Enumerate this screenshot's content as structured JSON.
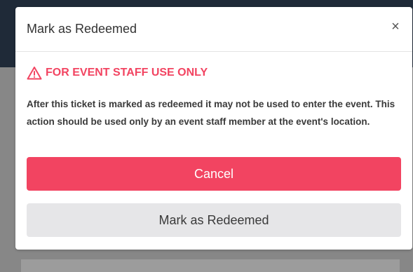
{
  "modal": {
    "title": "Mark as Redeemed",
    "close_icon": "close-icon",
    "close_glyph": "×",
    "warning": {
      "icon": "warning-triangle-icon",
      "text": "FOR EVENT STAFF USE ONLY",
      "color": "#f24461"
    },
    "description": "After this ticket is marked as redeemed it may not be used to enter the event. This action should be used only by an event staff member at the event's location.",
    "cancel_label": "Cancel",
    "redeem_label": "Mark as Redeemed"
  },
  "colors": {
    "accent": "#f24461",
    "secondary_button": "#e6e6e8",
    "header_backdrop": "#1f2a38"
  }
}
